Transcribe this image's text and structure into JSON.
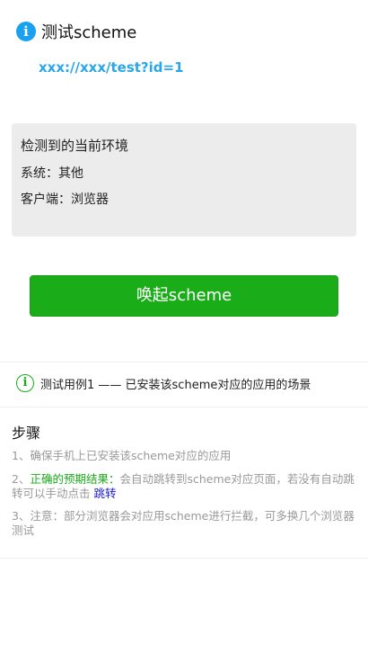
{
  "header": {
    "icon": "info-icon",
    "title": "测试scheme"
  },
  "scheme_url": "xxx://xxx/test?id=1",
  "environment": {
    "title": "检测到的当前环境",
    "system": "系统：其他",
    "client": "客户端：浏览器"
  },
  "launch_button": "唤起scheme",
  "test_case": {
    "icon": "info-outline-icon",
    "label": "测试用例1 —— 已安装该scheme对应的应用的场景"
  },
  "steps": {
    "title": "步骤",
    "step1": "1、确保手机上已安装该scheme对应的应用",
    "step2_prefix": "2、",
    "step2_highlight": "正确的预期结果：",
    "step2_text": "会自动跳转到scheme对应页面，若没有自动跳转可以手动点击",
    "step2_link": "跳转",
    "step3": "3、注意：部分浏览器会对应用scheme进行拦截，可多换几个浏览器测试"
  },
  "colors": {
    "primary_green": "#1aad19",
    "info_blue": "#1aa0f0",
    "url_blue": "#2aa7e6",
    "link_blue": "#1a1ad8",
    "panel_gray": "#ececec"
  }
}
